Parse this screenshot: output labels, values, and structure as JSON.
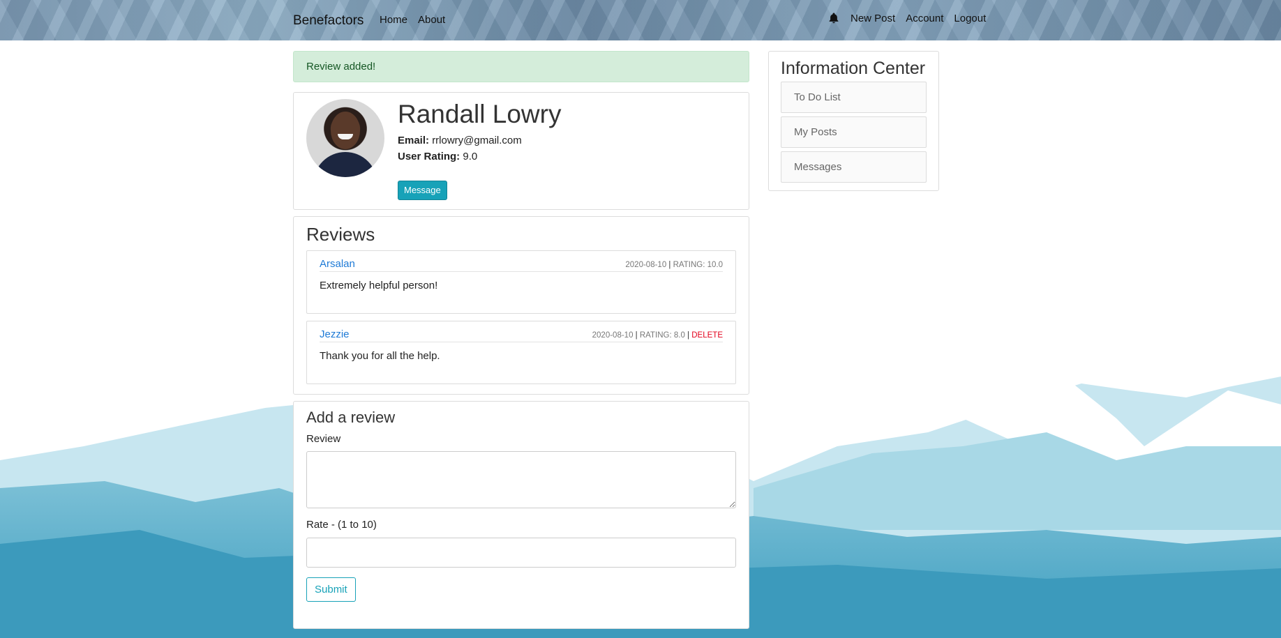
{
  "navbar": {
    "brand": "Benefactors",
    "left_links": [
      "Home",
      "About"
    ],
    "notification_icon": "bell-icon",
    "right_links": [
      "New Post",
      "Account",
      "Logout"
    ]
  },
  "alert": {
    "text": "Review added!",
    "color": "#d4edda"
  },
  "profile": {
    "name": "Randall Lowry",
    "email_label": "Email:",
    "email": "rrlowry@gmail.com",
    "rating_label": "User Rating:",
    "rating": "9.0",
    "message_button": "Message"
  },
  "reviews": {
    "title": "Reviews",
    "items": [
      {
        "author": "Arsalan",
        "date": "2020-08-10",
        "rating": "RATING: 10.0",
        "text": "Extremely helpful person!"
      },
      {
        "author": "Jezzie",
        "date": "2020-08-10",
        "rating": "RATING: 8.0",
        "delete": "DELETE",
        "text": "Thank you for all the help."
      }
    ],
    "separator": "|"
  },
  "add_review": {
    "title": "Add a review",
    "review_label": "Review",
    "review_value": "",
    "rate_label": "Rate - (1 to 10)",
    "rate_value": "",
    "submit": "Submit"
  },
  "info_center": {
    "title": "Information Center",
    "items": [
      "To Do List",
      "My Posts",
      "Messages"
    ]
  },
  "colors": {
    "accent": "#17a2b8",
    "link": "#1e7ad6",
    "delete": "#e3001b",
    "success_text": "#155724"
  }
}
